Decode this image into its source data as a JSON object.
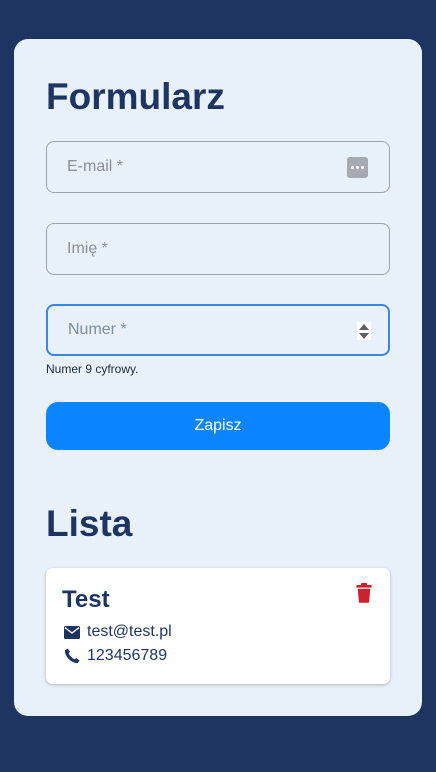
{
  "form": {
    "title": "Formularz",
    "email_placeholder": "E-mail *",
    "name_placeholder": "Imię *",
    "number_placeholder": "Numer *",
    "number_hint": "Numer 9 cyfrowy.",
    "submit_label": "Zapisz"
  },
  "list": {
    "title": "Lista",
    "items": [
      {
        "name": "Test",
        "email": "test@test.pl",
        "phone": "123456789"
      }
    ]
  },
  "icons": {
    "email": "envelope-icon",
    "phone": "phone-icon",
    "delete": "trash-icon",
    "password_manager": "password-manager-icon"
  },
  "colors": {
    "background": "#1e3461",
    "card": "#e8f0f9",
    "accent": "#0a84ff",
    "heading": "#1e3461",
    "delete": "#c8232c"
  }
}
